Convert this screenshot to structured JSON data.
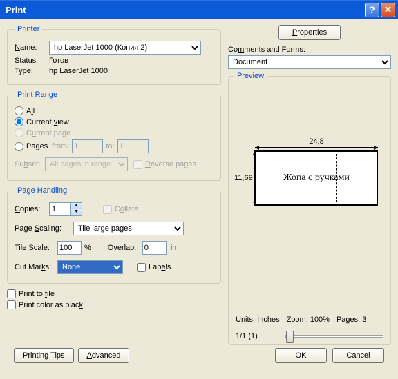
{
  "title": "Print",
  "printer": {
    "legend": "Printer",
    "name_label": "Name:",
    "name_value": "hp LaserJet 1000 (Копия 2)",
    "status_label": "Status:",
    "status_value": "Готов",
    "type_label": "Type:",
    "type_value": "hp LaserJet 1000",
    "properties_btn": "Properties",
    "comments_label": "Comments and Forms:",
    "comments_value": "Document"
  },
  "range": {
    "legend": "Print Range",
    "all": "All",
    "current_view": "Current view",
    "current_page": "Current page",
    "pages": "Pages",
    "from": "from:",
    "from_val": "1",
    "to": "to:",
    "to_val": "1",
    "subset": "Subset:",
    "subset_val": "All pages in range",
    "reverse": "Reverse pages"
  },
  "handling": {
    "legend": "Page Handling",
    "copies": "Copies:",
    "copies_val": "1",
    "collate": "Collate",
    "scaling": "Page Scaling:",
    "scaling_val": "Tile large pages",
    "tile_scale": "Tile Scale:",
    "tile_scale_val": "100",
    "percent": "%",
    "overlap": "Overlap:",
    "overlap_val": "0",
    "overlap_unit": "in",
    "cut_marks": "Cut Marks:",
    "cut_marks_val": "None",
    "labels": "Labels"
  },
  "options": {
    "print_to_file": "Print to file",
    "print_black": "Print color as black"
  },
  "preview": {
    "legend": "Preview",
    "width": "24,8",
    "height": "11,69",
    "content": "Жопа с ручками",
    "units": "Units: Inches",
    "zoom": "Zoom: 100%",
    "pages": "Pages: 3",
    "counter": "1/1 (1)"
  },
  "footer": {
    "tips": "Printing Tips",
    "advanced": "Advanced",
    "ok": "OK",
    "cancel": "Cancel"
  }
}
